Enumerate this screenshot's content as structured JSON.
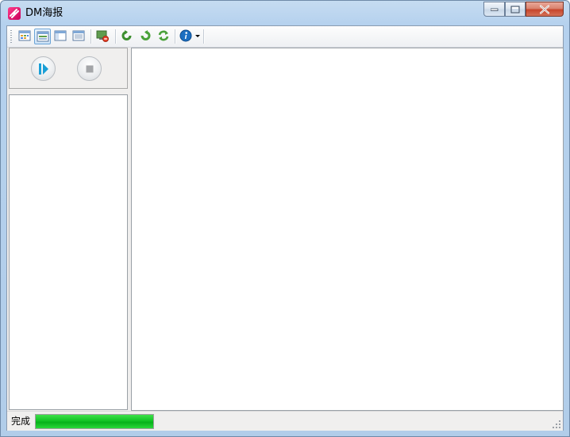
{
  "window": {
    "title": "DM海报",
    "icon": "app-logo-icon",
    "caption_buttons": [
      "minimize-icon",
      "maximize-icon",
      "close-icon"
    ]
  },
  "toolbar": {
    "buttons": [
      {
        "name": "view-thumbnails",
        "icon": "grid-view-icon",
        "active": false
      },
      {
        "name": "view-tiles",
        "icon": "tile-view-icon",
        "active": true
      },
      {
        "name": "view-preview",
        "icon": "preview-view-icon",
        "active": false
      },
      {
        "name": "view-list",
        "icon": "list-view-icon",
        "active": false
      },
      {
        "name": "stop-task",
        "icon": "monitor-stop-icon",
        "active": false
      },
      {
        "name": "back",
        "icon": "refresh-back-icon",
        "active": false
      },
      {
        "name": "forward",
        "icon": "refresh-forward-icon",
        "active": false
      },
      {
        "name": "sync",
        "icon": "sync-icon",
        "active": false
      },
      {
        "name": "info",
        "icon": "info-icon",
        "active": false,
        "has_dropdown": true
      }
    ]
  },
  "controls": {
    "play_icon": "play-icon",
    "stop_icon": "stop-icon"
  },
  "status": {
    "text": "完成",
    "progress": 1.0
  },
  "colors": {
    "progress_green": "#12c425",
    "titlebar_blue": "#b5d1ee",
    "play_accent": "#1a9fd6"
  }
}
